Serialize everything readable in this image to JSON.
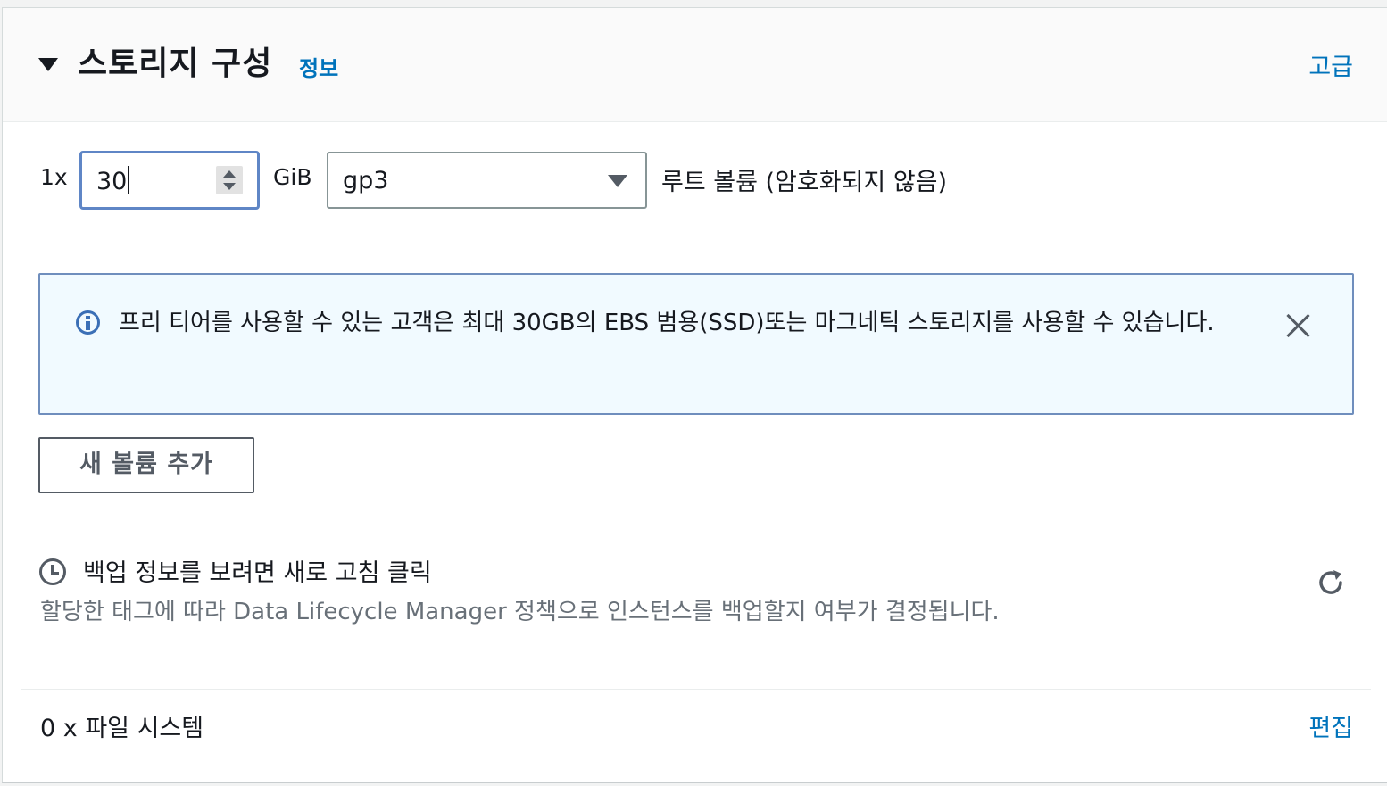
{
  "header": {
    "title": "스토리지 구성",
    "info_link": "정보",
    "advanced_link": "고급"
  },
  "volume": {
    "count_label": "1x",
    "size_value": "30",
    "unit_label": "GiB",
    "type_value": "gp3",
    "description": "루트 볼륨  (암호화되지 않음)"
  },
  "alert": {
    "message": "프리 티어를 사용할 수 있는 고객은 최대 30GB의 EBS 범용(SSD)또는 마그네틱 스토리지를 사용할 수 있습니다."
  },
  "add_volume_button": "새 볼륨 추가",
  "backup": {
    "title": "백업 정보를 보려면 새로 고침 클릭",
    "description": "할당한 태그에 따라 Data Lifecycle Manager 정책으로 인스턴스를 백업할지 여부가 결정됩니다."
  },
  "file_systems": {
    "label": "0 x 파일 시스템",
    "edit_link": "편집"
  },
  "colors": {
    "link": "#0073bb",
    "alert_bg": "#f1faff",
    "alert_border": "#6f8ebd",
    "input_focus": "#5f86c6",
    "secondary_text": "#687078"
  },
  "icons": {
    "collapse": "caret-down-icon",
    "info": "info-icon",
    "close": "close-icon",
    "clock": "clock-icon",
    "refresh": "refresh-icon"
  }
}
